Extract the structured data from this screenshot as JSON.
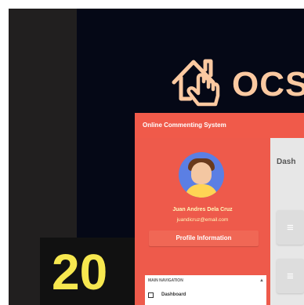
{
  "brand": {
    "logo_text": "OCS",
    "icon": "house-pointer-icon"
  },
  "app": {
    "title": "Online Commenting System"
  },
  "user": {
    "name": "Juan Andres Dela Cruz",
    "email": "juandicruz@email.com"
  },
  "sidebar": {
    "profile_button": "Profile Information",
    "section_label": "MAIN NAVIGATION",
    "items": [
      {
        "label": "Dashboard",
        "icon": "dashboard-icon"
      }
    ]
  },
  "main": {
    "page_title": "Dash"
  },
  "overlay": {
    "badge_text": "20"
  },
  "colors": {
    "brand_text": "#fbc9a1",
    "topbar": "#f05a4a",
    "sidebar": "#ee5a4b",
    "badge_text": "#f7e84f"
  }
}
